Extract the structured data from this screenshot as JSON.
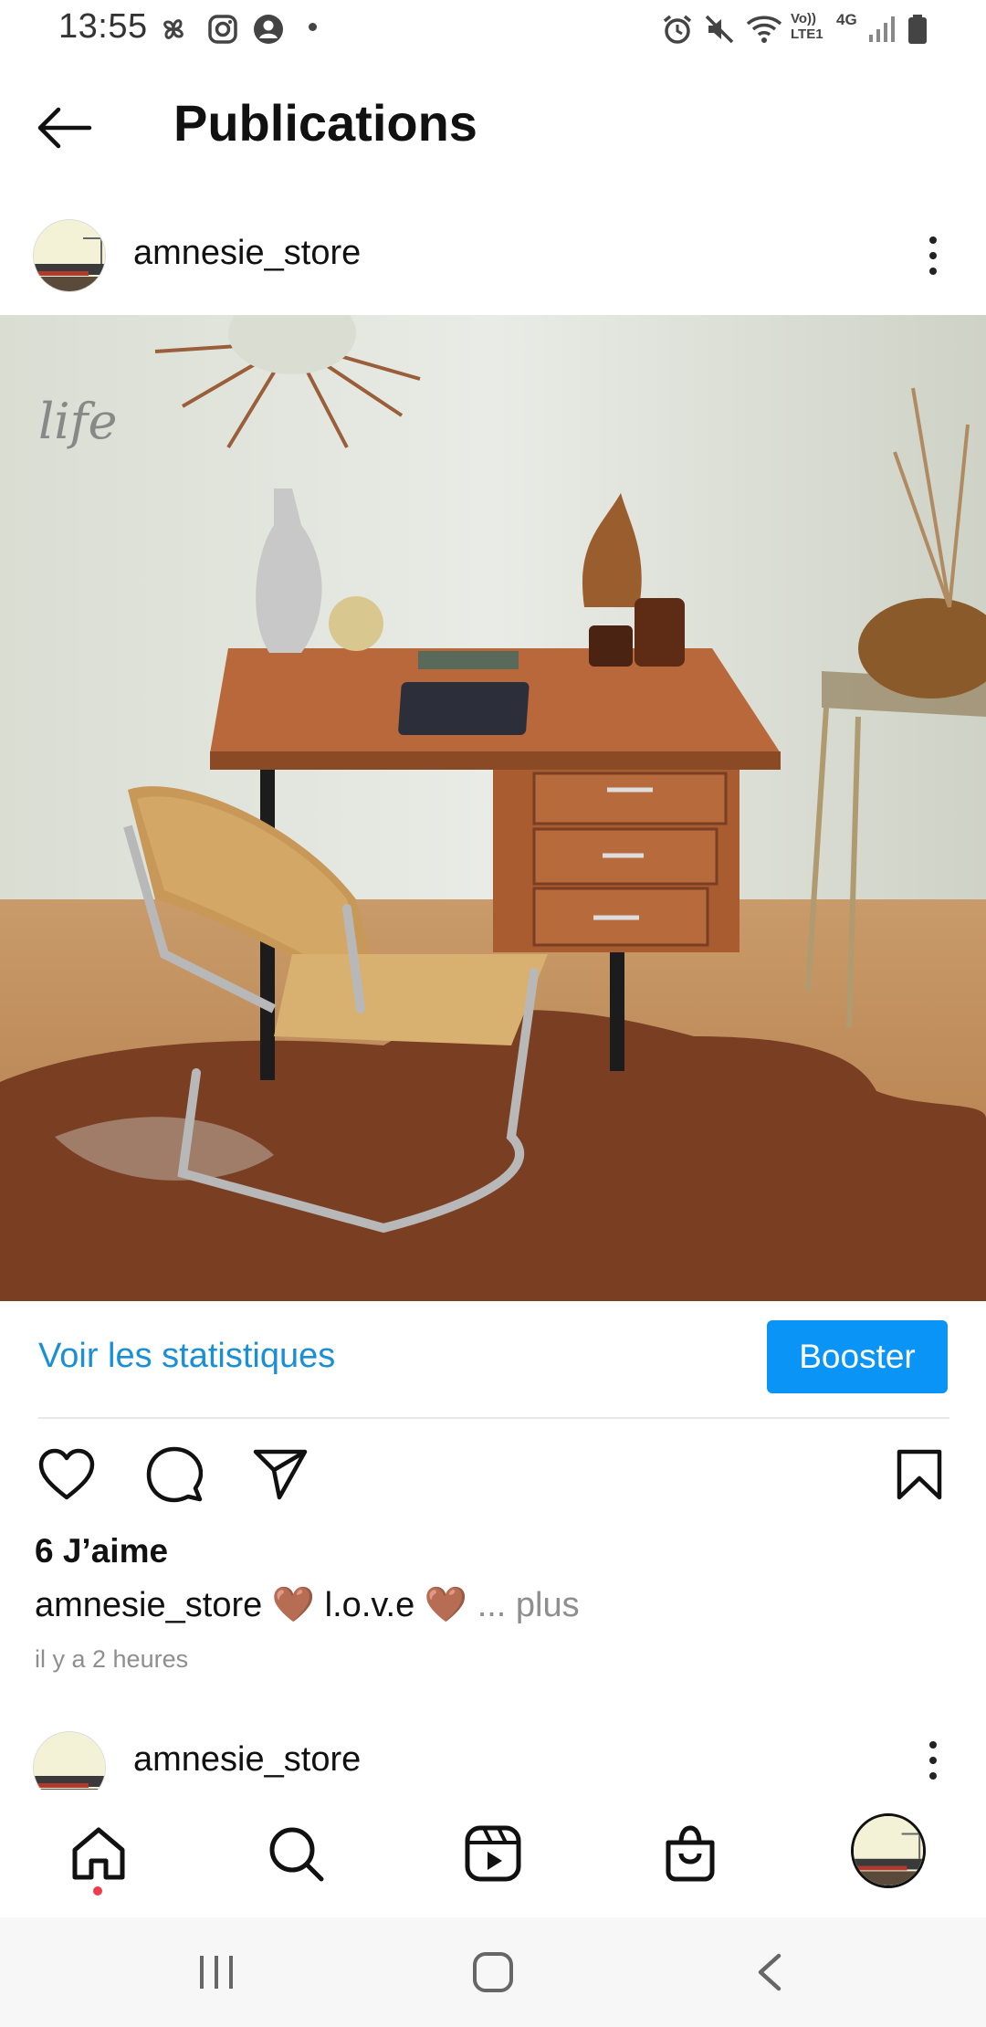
{
  "status_bar": {
    "time": "13:55",
    "left_icons": [
      "pinwheel-icon",
      "instagram-icon",
      "account-icon",
      "dot-icon"
    ],
    "right_icons": [
      "alarm-icon",
      "mute-icon",
      "wifi-icon",
      "volte-icon",
      "4g-icon",
      "signal-icon",
      "battery-icon"
    ],
    "volte_label": "Vo)) LTE1",
    "network_label": "4G"
  },
  "header": {
    "title": "Publications",
    "back_icon": "back-arrow-icon"
  },
  "post": {
    "username": "amnesie_store",
    "image_description_icon": "post-photo",
    "insights_label": "Voir les statistiques",
    "boost_label": "Booster",
    "likes_label": "6 J’aime",
    "caption_user": "amnesie_store",
    "caption_text": "🤎 l.o.v.e 🤎",
    "caption_more": "... plus",
    "timestamp": "il y a 2 heures"
  },
  "next_post": {
    "username": "amnesie_store"
  },
  "bottom_nav": {
    "items": [
      "home-icon",
      "search-icon",
      "reels-icon",
      "shop-icon",
      "profile-avatar"
    ]
  },
  "system_nav": {
    "items": [
      "recents-icon",
      "home-button-icon",
      "back-icon"
    ]
  },
  "colors": {
    "accent": "#0a95f6",
    "link": "#1a8fd6",
    "notification": "#ef3b4d",
    "muted": "#8e8e8e"
  }
}
